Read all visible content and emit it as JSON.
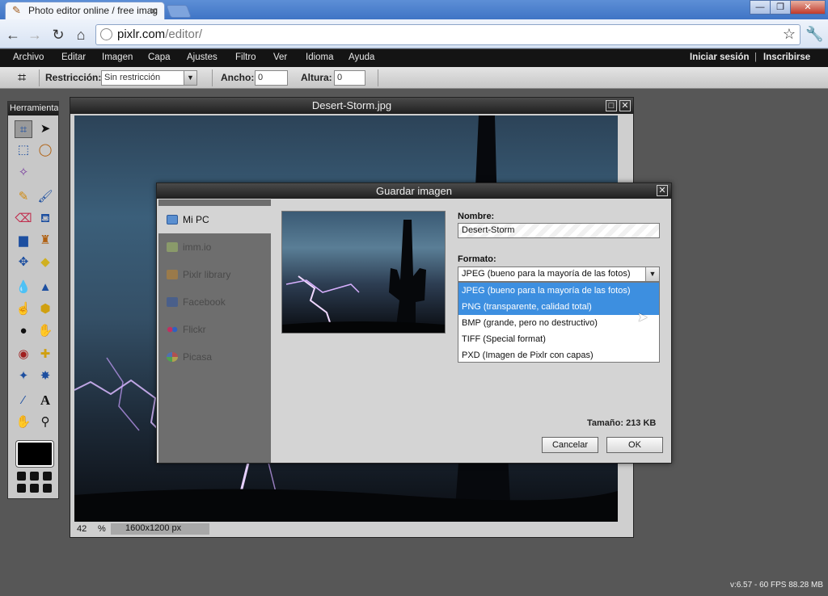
{
  "browser": {
    "tab_title": "Photo editor online / free imag",
    "url_host": "pixlr.com",
    "url_path": "/editor/"
  },
  "menu": {
    "items": [
      "Archivo",
      "Editar",
      "Imagen",
      "Capa",
      "Ajustes",
      "Filtro",
      "Ver",
      "Idioma",
      "Ayuda"
    ],
    "login": "Iniciar sesión",
    "separator": "|",
    "register": "Inscribirse"
  },
  "options": {
    "restriction_label": "Restricción:",
    "restriction_value": "Sin restricción",
    "width_label": "Ancho:",
    "width_value": "0",
    "height_label": "Altura:",
    "height_value": "0"
  },
  "tools_panel": {
    "title": "Herramientas"
  },
  "document": {
    "title": "Desert-Storm.jpg",
    "zoom_value": "42",
    "zoom_unit": "%",
    "dimensions": "1600x1200 px"
  },
  "dialog": {
    "title": "Guardar imagen",
    "sidebar": [
      "Mi PC",
      "imm.io",
      "Pixlr library",
      "Facebook",
      "Flickr",
      "Picasa"
    ],
    "name_label": "Nombre:",
    "name_value": "Desert-Storm",
    "format_label": "Formato:",
    "format_selected": "JPEG (bueno para la mayoría de las fotos)",
    "format_options": [
      "JPEG (bueno para la mayoría de las fotos)",
      "PNG (transparente, calidad total)",
      "BMP (grande, pero no destructivo)",
      "TIFF (Special format)",
      "PXD (Imagen de Pixlr con capas)"
    ],
    "size_text": "Tamaño: 213 KB",
    "cancel_label": "Cancelar",
    "ok_label": "OK"
  },
  "footer": {
    "fps_text": "v:6.57 - 60 FPS 88.28 MB"
  },
  "colors": {
    "selection": "#3d8fe0",
    "menubar": "#141414",
    "workspace": "#575757"
  }
}
